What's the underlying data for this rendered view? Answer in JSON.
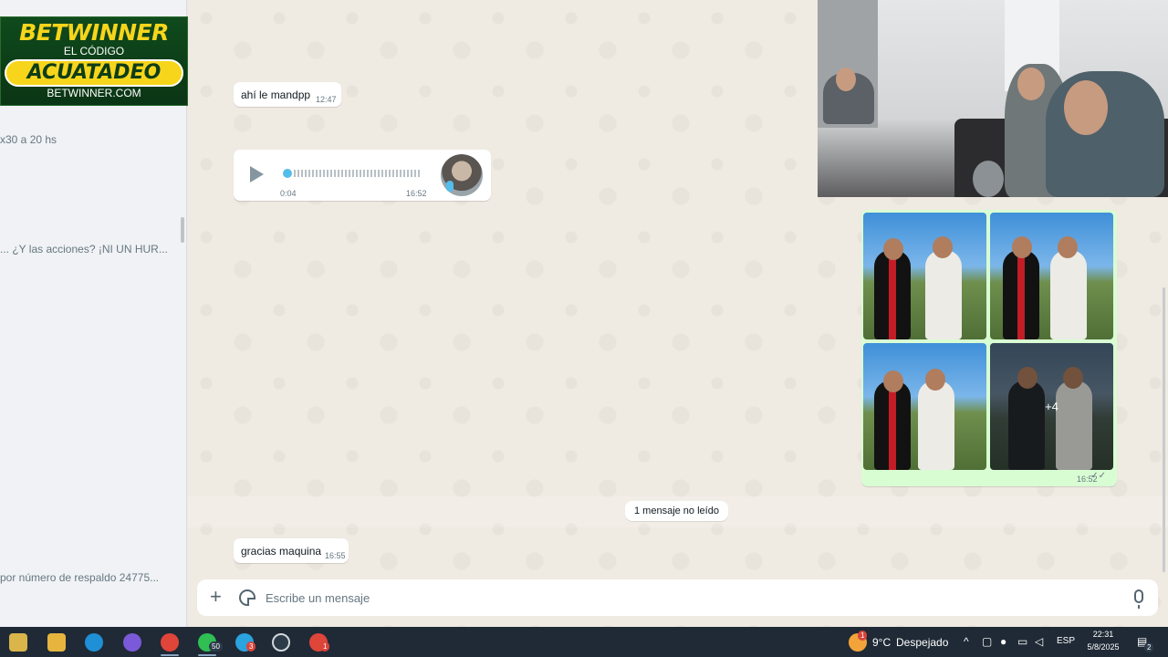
{
  "chat_list": {
    "snippets": [
      "x30 a 20 hs",
      "... ¿Y las acciones? ¡NI UN HUR...",
      "por número de respaldo 24775..."
    ]
  },
  "sponsor": {
    "brand": "BETWINNER",
    "subtitle": "EL CÓDIGO",
    "code": "ACUATADEO",
    "site": "BETWINNER.COM"
  },
  "messages": {
    "m1": {
      "text": "ahí le mandpp",
      "time": "12:47"
    },
    "voice": {
      "duration": "0:04",
      "time": "16:52"
    },
    "images": {
      "more_count": "+4",
      "time": "16:52"
    },
    "unread_divider": "1 mensaje no leído",
    "m2": {
      "text": "gracias maquina",
      "time": "16:55"
    }
  },
  "composer": {
    "plus": "+",
    "placeholder": "Escribe un mensaje"
  },
  "taskbar": {
    "whatsapp_badge": "50",
    "telegram_badge": "3",
    "chrome_badge": "1",
    "weather_temp": "9°C",
    "weather_desc": "Despejado",
    "weather_alert": "1",
    "language": "ESP",
    "time": "22:31",
    "date": "5/8/2025",
    "notifications": "2"
  },
  "colors": {
    "chat_bg": "#efeae2",
    "outgoing_bubble": "#d9fdd3",
    "accent_blue": "#53bdeb",
    "taskbar_bg": "#1f2a36",
    "sponsor_yellow": "#f7d51b"
  }
}
